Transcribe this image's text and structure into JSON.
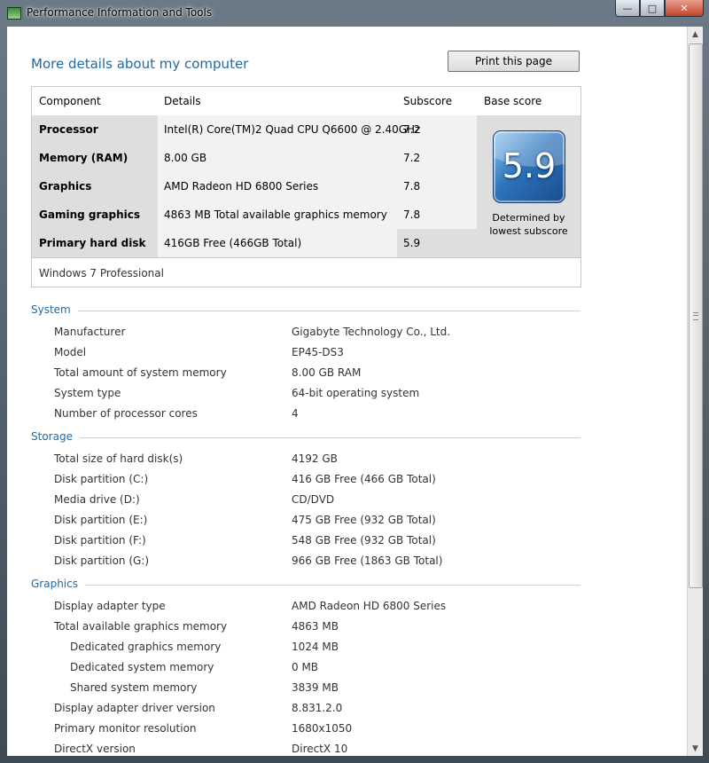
{
  "window": {
    "title": "Performance Information and Tools"
  },
  "page": {
    "title": "More details about my computer",
    "print_label": "Print this page"
  },
  "scores": {
    "headers": {
      "component": "Component",
      "details": "Details",
      "subscore": "Subscore",
      "base": "Base score"
    },
    "rows": [
      {
        "component": "Processor",
        "details": "Intel(R) Core(TM)2 Quad CPU Q6600 @ 2.40GHz",
        "subscore": "7.2"
      },
      {
        "component": "Memory (RAM)",
        "details": "8.00 GB",
        "subscore": "7.2"
      },
      {
        "component": "Graphics",
        "details": "AMD Radeon HD 6800 Series",
        "subscore": "7.8"
      },
      {
        "component": "Gaming graphics",
        "details": "4863 MB Total available graphics memory",
        "subscore": "7.8"
      },
      {
        "component": "Primary hard disk",
        "details": "416GB Free (466GB Total)",
        "subscore": "5.9"
      }
    ],
    "base_score": "5.9",
    "base_note_line1": "Determined by",
    "base_note_line2": "lowest subscore",
    "os": "Windows 7 Professional"
  },
  "system": {
    "title": "System",
    "items": [
      {
        "key": "Manufacturer",
        "value": "Gigabyte Technology Co., Ltd."
      },
      {
        "key": "Model",
        "value": "EP45-DS3"
      },
      {
        "key": "Total amount of system memory",
        "value": "8.00 GB RAM"
      },
      {
        "key": "System type",
        "value": "64-bit operating system"
      },
      {
        "key": "Number of processor cores",
        "value": "4"
      }
    ]
  },
  "storage": {
    "title": "Storage",
    "items": [
      {
        "key": "Total size of hard disk(s)",
        "value": "4192 GB"
      },
      {
        "key": "Disk partition (C:)",
        "value": "416 GB Free (466 GB Total)"
      },
      {
        "key": "Media drive (D:)",
        "value": "CD/DVD"
      },
      {
        "key": "Disk partition (E:)",
        "value": "475 GB Free (932 GB Total)"
      },
      {
        "key": "Disk partition (F:)",
        "value": "548 GB Free (932 GB Total)"
      },
      {
        "key": "Disk partition (G:)",
        "value": "966 GB Free (1863 GB Total)"
      }
    ]
  },
  "graphics": {
    "title": "Graphics",
    "items": [
      {
        "key": "Display adapter type",
        "value": "AMD Radeon HD 6800 Series"
      },
      {
        "key": "Total available graphics memory",
        "value": "4863 MB"
      },
      {
        "key": "Dedicated graphics memory",
        "value": "1024 MB"
      },
      {
        "key": "Dedicated system memory",
        "value": "0 MB"
      },
      {
        "key": "Shared system memory",
        "value": "3839 MB"
      },
      {
        "key": "Display adapter driver version",
        "value": "8.831.2.0"
      },
      {
        "key": "Primary monitor resolution",
        "value": "1680x1050"
      },
      {
        "key": "DirectX version",
        "value": "DirectX 10"
      }
    ]
  }
}
